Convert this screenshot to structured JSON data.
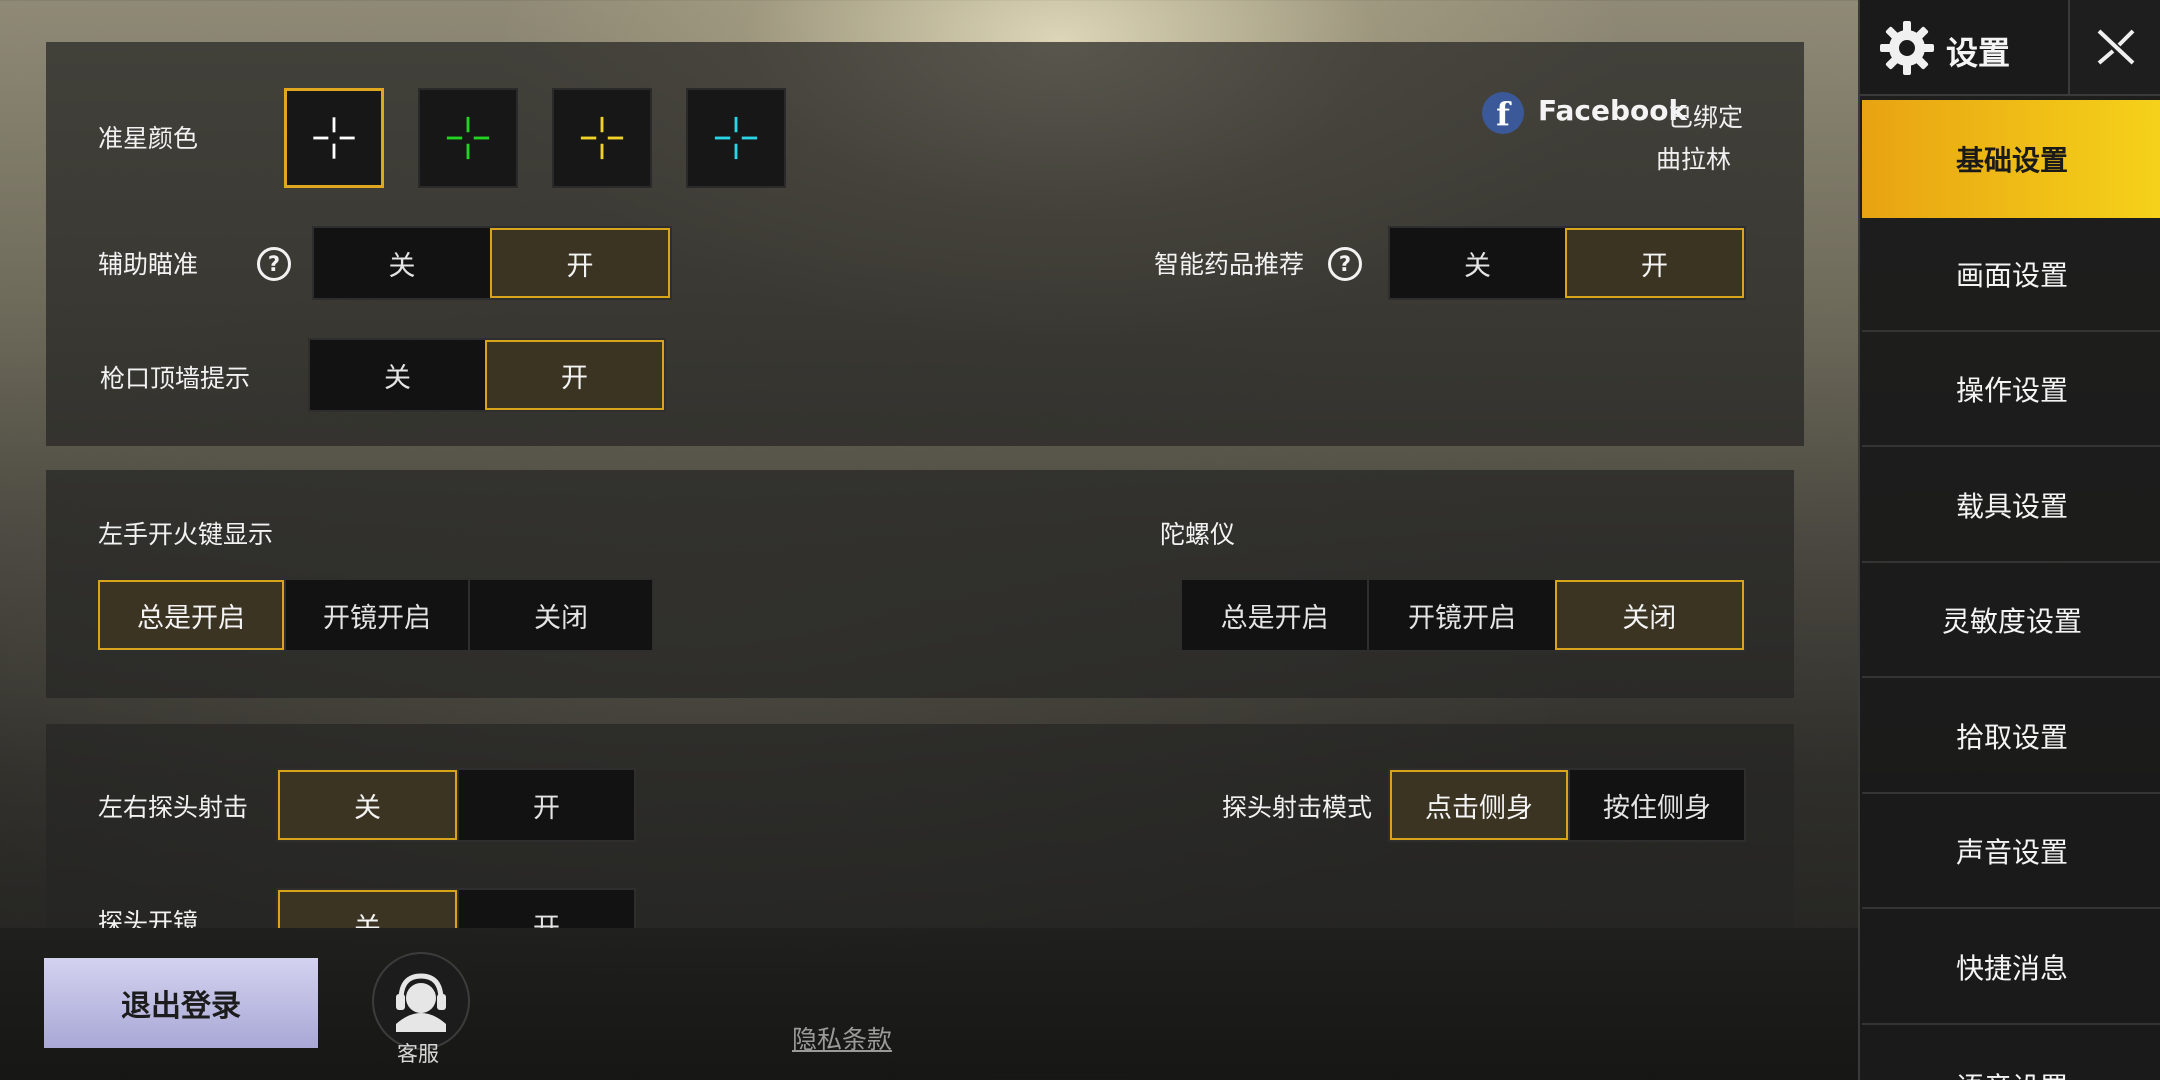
{
  "crosshair": {
    "label": "准星颜色",
    "colors": [
      "#ffffff",
      "#22d422",
      "#f0d22a",
      "#2ad6e6"
    ],
    "selected_index": 0
  },
  "account": {
    "platform": "Facebook",
    "status": "已绑定",
    "name": "曲拉林"
  },
  "aim_assist": {
    "label": "辅助瞄准",
    "off": "关",
    "on": "开",
    "value": "开"
  },
  "smart_meds": {
    "label": "智能药品推荐",
    "off": "关",
    "on": "开",
    "value": "开"
  },
  "muzzle_wall": {
    "label": "枪口顶墙提示",
    "off": "关",
    "on": "开",
    "value": "开"
  },
  "left_fire": {
    "label": "左手开火键显示",
    "options": [
      "总是开启",
      "开镜开启",
      "关闭"
    ],
    "value": "总是开启"
  },
  "gyroscope": {
    "label": "陀螺仪",
    "options": [
      "总是开启",
      "开镜开启",
      "关闭"
    ],
    "value": "关闭"
  },
  "peek_fire": {
    "label": "左右探头射击",
    "off": "关",
    "on": "开",
    "value": "关"
  },
  "peek_mode": {
    "label": "探头射击模式",
    "options": [
      "点击侧身",
      "按住侧身"
    ],
    "value": "点击侧身"
  },
  "peek_scope": {
    "label": "探头开镜",
    "off": "关",
    "on": "开",
    "value": "关"
  },
  "footer": {
    "logout": "退出登录",
    "support": "客服",
    "privacy": "隐私条款"
  },
  "sidebar": {
    "title": "设置",
    "items": [
      "基础设置",
      "画面设置",
      "操作设置",
      "载具设置",
      "灵敏度设置",
      "拾取设置",
      "声音设置",
      "快捷消息"
    ],
    "active_index": 0,
    "partial_item": "语音设置"
  }
}
